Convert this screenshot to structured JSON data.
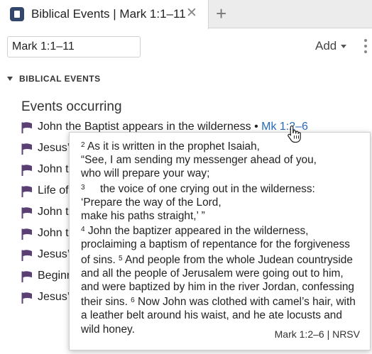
{
  "tab": {
    "title": "Biblical Events | Mark 1:1–11",
    "close_glyph": "✕",
    "add_glyph": "+"
  },
  "toolbar": {
    "reference_value": "Mark 1:1–11",
    "add_label": "Add"
  },
  "section": {
    "title": "BIBLICAL EVENTS",
    "heading": "Events occurring"
  },
  "events": [
    {
      "label": "John the Baptist appears in the wilderness",
      "separator": " • ",
      "reference": "Mk 1:2–6"
    },
    {
      "label": "Jesus’",
      "separator": "",
      "reference": ""
    },
    {
      "label": "John t",
      "separator": "",
      "reference": ""
    },
    {
      "label": "Life of",
      "separator": "",
      "reference": ""
    },
    {
      "label": "John t",
      "separator": "",
      "reference": ""
    },
    {
      "label": "John t",
      "separator": "",
      "reference": ""
    },
    {
      "label": "Jesus’",
      "separator": "",
      "reference": ""
    },
    {
      "label": "Beginn",
      "separator": "",
      "reference": ""
    },
    {
      "label": "Jesus’",
      "separator": "",
      "reference": ""
    }
  ],
  "popup": {
    "v2_num": "2",
    "v2_text": "As it is written in the prophet Isaiah,",
    "v2_line2": "“See, I am sending my messenger ahead of you,",
    "v2_line3": "who will prepare your way;",
    "v3_num": "3",
    "v3_text": "the voice of one crying out in the wilderness:",
    "v3_line2": "‘Prepare the way of the Lord,",
    "v3_line3": "make his paths straight,’ ”",
    "v4_num": "4",
    "v4_text": "John the baptizer appeared in the wilderness, proclaiming a baptism of repentance for the forgiveness of sins.",
    "v5_num": "5",
    "v5_text": "And people from the whole Judean countryside and all the people of Jerusalem were going out to him, and were baptized by him in the river Jordan, confessing their sins.",
    "v6_num": "6",
    "v6_text": "Now John was clothed with camel’s hair, with a leather belt around his waist, and he ate locusts and wild honey.",
    "citation": "Mark 1:2–6 | NRSV"
  },
  "colors": {
    "flag": "#5a3f73",
    "link": "#2a6bb5",
    "tab_icon": "#33466b"
  }
}
